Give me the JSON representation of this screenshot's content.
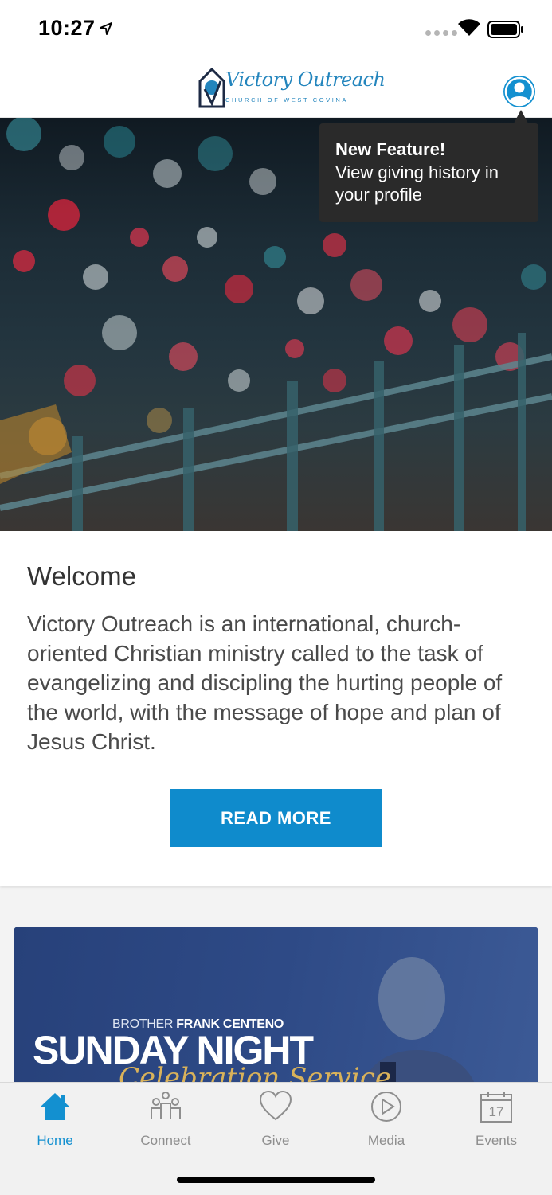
{
  "status_bar": {
    "time": "10:27"
  },
  "header": {
    "logo_script": "Victory Outreach",
    "logo_subtitle": "CHURCH OF WEST COVINA"
  },
  "tooltip": {
    "title": "New Feature!",
    "body": "View giving history in your profile"
  },
  "welcome": {
    "title": "Welcome",
    "text": "Victory Outreach is an international, church-oriented Christian ministry called to the task of evangelizing and discipling the hurting people of the world, with the message of hope and plan of Jesus Christ.",
    "button": "READ MORE"
  },
  "promo": {
    "kicker_prefix": "BROTHER",
    "kicker_name": "FRANK CENTENO",
    "title": "SUNDAY NIGHT",
    "script": "Celebration Service"
  },
  "tabs": [
    {
      "label": "Home",
      "icon": "home-icon"
    },
    {
      "label": "Connect",
      "icon": "connect-icon"
    },
    {
      "label": "Give",
      "icon": "heart-icon"
    },
    {
      "label": "Media",
      "icon": "play-icon"
    },
    {
      "label": "Events",
      "icon": "calendar-icon"
    }
  ],
  "events_icon_day": "17",
  "colors": {
    "accent": "#1390d0",
    "button": "#0f8bcc",
    "tooltip": "#2a2a2a"
  }
}
